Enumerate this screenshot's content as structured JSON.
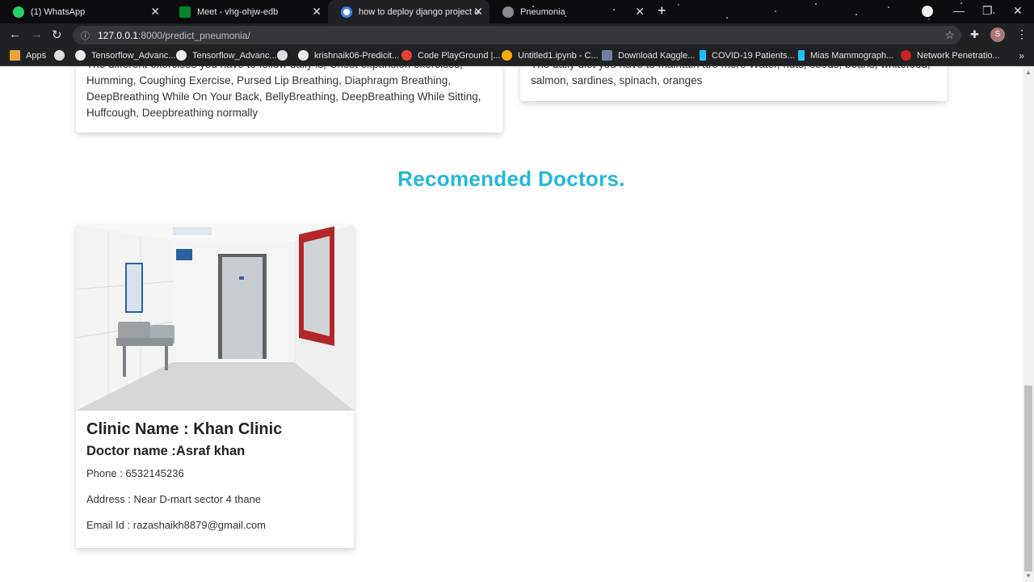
{
  "browser": {
    "tabs": [
      {
        "title": "(1) WhatsApp",
        "active": false,
        "favicon": "whatsapp-icon",
        "color": "#25d366"
      },
      {
        "title": "Meet - vhg-ohjw-edb",
        "active": false,
        "favicon": "meet-icon",
        "color": "#00832d"
      },
      {
        "title": "how to deploy django project on",
        "active": true,
        "favicon": "google-icon",
        "color": "#4285f4"
      },
      {
        "title": "Pneumonia",
        "active": false,
        "favicon": "globe-icon",
        "color": "#8a8a8a"
      }
    ],
    "url": {
      "host": "127.0.0.1",
      "rest": ":8000/predict_pneumonia/"
    },
    "profile_initial": "S",
    "bookmarks": [
      {
        "label": "Apps",
        "icon": "apps-grid-icon",
        "color": "#e8a33d"
      },
      {
        "label": "",
        "icon": "globe-icon",
        "color": "#ddd"
      },
      {
        "label": "Tensorflow_Advanc...",
        "icon": "github-icon",
        "color": "#eee"
      },
      {
        "label": "Tensorflow_Advanc...",
        "icon": "github-icon",
        "color": "#eee"
      },
      {
        "label": "",
        "icon": "globe-icon",
        "color": "#ddd"
      },
      {
        "label": "krishnaik06-Predicit...",
        "icon": "github-icon",
        "color": "#eee"
      },
      {
        "label": "Code PlayGround |...",
        "icon": "chrome-icon",
        "color": "#e94235"
      },
      {
        "label": "Untitled1.ipynb - C...",
        "icon": "colab-icon",
        "color": "#f9ab00"
      },
      {
        "label": "Download Kaggle...",
        "icon": "kaggle-icon",
        "color": "#6e7fa3"
      },
      {
        "label": "COVID-19 Patients...",
        "icon": "k-icon",
        "color": "#20beff"
      },
      {
        "label": "Mias Mammograph...",
        "icon": "k-icon",
        "color": "#20beff"
      },
      {
        "label": "Network Penetratio...",
        "icon": "vivaldi-icon",
        "color": "#cc2222"
      }
    ]
  },
  "page": {
    "exercise_text": "The different exercises you have to follow daily is, Chest expansion exercises, Humming, Coughing Exercise, Pursed Lip Breathing, Diaphragm Breathing, DeepBreathing While On Your Back, BellyBreathing, DeepBreathing While Sitting, Huffcough, Deepbreathing normally",
    "diet_text": "The daily diet you have to maintain are more Water, nuts, seeds, beans, whitefood, salmon, sardines, spinach, oranges",
    "section_title": "Recomended Doctors.",
    "doctor": {
      "clinic": "Clinic Name : Khan Clinic",
      "name": "Doctor name :Asraf khan",
      "phone": "Phone : 6532145236",
      "address": "Address : Near D-mart sector 4 thane",
      "email": "Email Id : razashaikh8879@gmail.com"
    }
  },
  "colors": {
    "accent": "#23b7d9",
    "chrome_bg": "#202124"
  }
}
